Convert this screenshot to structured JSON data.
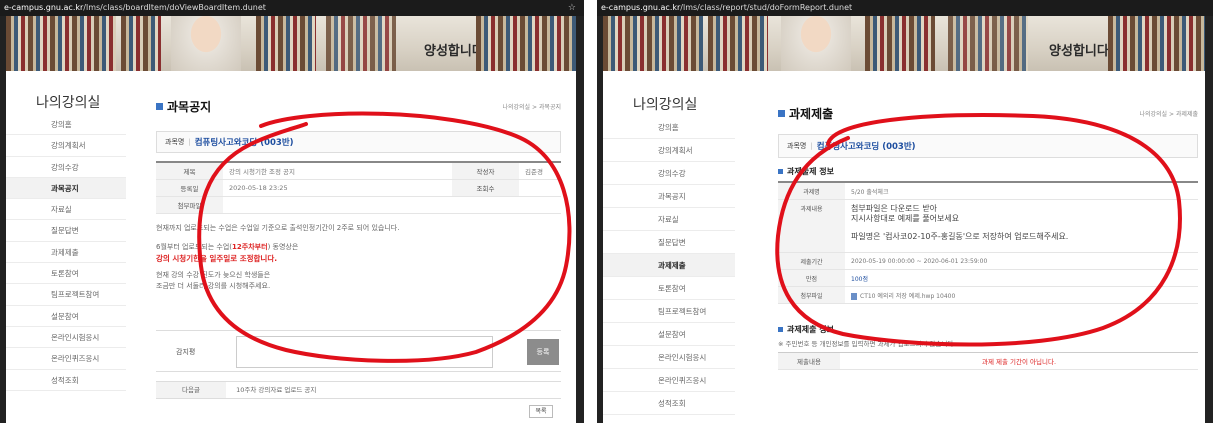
{
  "left": {
    "url_host": "e-campus.gnu.ac.kr",
    "url_path": "/lms/class/boardItem/doViewBoardItem.dunet",
    "star": "☆",
    "banner_slogan": "양성합니다",
    "sidebar": {
      "title": "나의강의실",
      "items": [
        "강의홈",
        "강의계획서",
        "강의수강",
        "과목공지",
        "자료실",
        "질문답변",
        "과제제출",
        "토론참여",
        "팀프로젝트참여",
        "설문참여",
        "온라인시험응시",
        "온라인퀴즈응시",
        "성적조회"
      ],
      "active_index": 3
    },
    "page_title": "과목공지",
    "breadcrumb": "나의강의실 > 과목공지",
    "course_label": "과목명",
    "course_name": "컴퓨팅사고와코딩 (003반)",
    "post": {
      "title_label": "제목",
      "title_value": "강의 시청기한 조정 공지",
      "author_label": "작성자",
      "author_value": "김준경",
      "date_label": "등록일",
      "date_value": "2020-05-18 23:25",
      "views_label": "조회수",
      "attach_label": "첨부파일"
    },
    "body": {
      "line1": "현재까지 업로드되는 수업은 수업일 기준으로 출석인정기간이 2주로 되어 있습니다.",
      "line2": "6월부터 업로드되는 수업(",
      "line2_red": "12주차부터",
      "line2_end": ") 동영상은",
      "line3_red": "강의 시청기한을 일주일로 조정합니다.",
      "line4": "현재 강의 수강 진도가 늦으신 학생들은",
      "line5": "조금만 더 서둘러 강의를 시청해주세요."
    },
    "comment_label": "감지평",
    "register_button": "등록",
    "next_label": "다음글",
    "next_value": "10주차 강의자료 업로드 공지",
    "list_button": "목록"
  },
  "right": {
    "url_host": "e-campus.gnu.ac.kr",
    "url_path": "/lms/class/report/stud/doFormReport.dunet",
    "banner_slogan": "양성합니다",
    "sidebar": {
      "title": "나의강의실",
      "items": [
        "강의홈",
        "강의계획서",
        "강의수강",
        "과목공지",
        "자료실",
        "질문답변",
        "과제제출",
        "토론참여",
        "팀프로젝트참여",
        "설문참여",
        "온라인시험응시",
        "온라인퀴즈응시",
        "성적조회"
      ],
      "active_index": 6
    },
    "page_title": "과제제출",
    "breadcrumb": "나의강의실 > 과제제출",
    "course_label": "과목명",
    "course_name": "컴퓨팅사고와코딩 (003반)",
    "info_title": "과제출제 정보",
    "info": {
      "name_label": "과제명",
      "name_value": "5/20 출석체크",
      "content_label": "과제내용",
      "content_line1": "첨부파일은 다운로드 받아",
      "content_line2": "지시사항대로 예제를 풀어보세요",
      "content_line3": "파일명은 '컴사코02-10주-홍길동'으로 저장하여 업로드해주세요.",
      "period_label": "제출기간",
      "period_value": "2020-05-19 00:00:00 ~ 2020-06-01 23:59:00",
      "score_label": "만점",
      "score_value": "100점",
      "attach_label": "첨부파일",
      "attach_value": "CT10 예외리 저장 예제.hwp 10400"
    },
    "submit_title": "과제제출 정보",
    "submit_note": "※ 주민번호 등 개인정보를 입력하면 과제가 업로드되지 않습니다.",
    "submit_label": "제출내용",
    "submit_value": "과제 제출 기간이 아닙니다."
  },
  "colors": {
    "accent_blue": "#3a74c4",
    "link_blue": "#1f4fa0",
    "annotation_red": "#e0101a",
    "notice_red": "#d22222"
  }
}
